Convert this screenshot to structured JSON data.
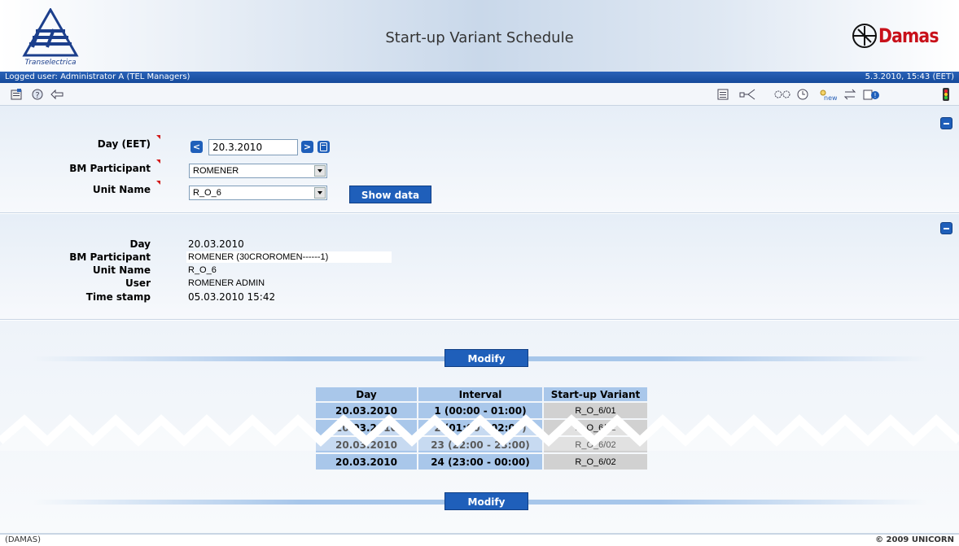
{
  "header": {
    "title": "Start-up Variant Schedule",
    "left_logo_text": "Transelectrica",
    "right_logo_text": "Damas"
  },
  "userbar": {
    "logged_user": "Logged user: Administrator A (TEL Managers)",
    "datetime": "5.3.2010, 15:43  (EET)"
  },
  "toolbar": {
    "left_icons": [
      "page-info-icon",
      "help-icon",
      "back-arrow-icon"
    ],
    "right_icons": [
      "list-icon",
      "diagram-icon",
      "settings-gears-icon",
      "clock-icon",
      "new-icon",
      "transfer-icon",
      "messages-icon",
      "traffic-light-icon"
    ]
  },
  "filter": {
    "day_label": "Day (EET)",
    "day_value": "20.3.2010",
    "prev_glyph": "<",
    "next_glyph": ">",
    "bm_label": "BM Participant",
    "bm_value": "ROMENER",
    "unit_label": "Unit Name",
    "unit_value": "R_O_6",
    "show_button": "Show data"
  },
  "info": {
    "day_label": "Day",
    "day_value": "20.03.2010",
    "bm_label": "BM Participant",
    "bm_value": "ROMENER (30CROROMEN------1)",
    "unit_label": "Unit Name",
    "unit_value": "R_O_6",
    "user_label": "User",
    "user_value": "ROMENER ADMIN",
    "ts_label": "Time stamp",
    "ts_value": "05.03.2010 15:42"
  },
  "schedule": {
    "modify_label": "Modify",
    "headers": [
      "Day",
      "Interval",
      "Start-up Variant"
    ],
    "rows": [
      [
        "20.03.2010",
        "1 (00:00 - 01:00)",
        "R_O_6/01"
      ],
      [
        "20.03.2010",
        "2 (01:00 - 02:00)",
        "R_O_6/02"
      ],
      [
        "20.03.2010",
        "23 (22:00 - 23:00)",
        "R_O_6/02"
      ],
      [
        "20.03.2010",
        "24 (23:00 - 00:00)",
        "R_O_6/02"
      ]
    ]
  },
  "footer": {
    "left": "(DAMAS)",
    "right": "© 2009 UNICORN"
  },
  "colors": {
    "accent": "#1f5fba",
    "table_header": "#a9c7ea",
    "variant_cell": "#d1d1d1",
    "required_marker": "#d21b1b",
    "brand_red": "#c8111a"
  }
}
